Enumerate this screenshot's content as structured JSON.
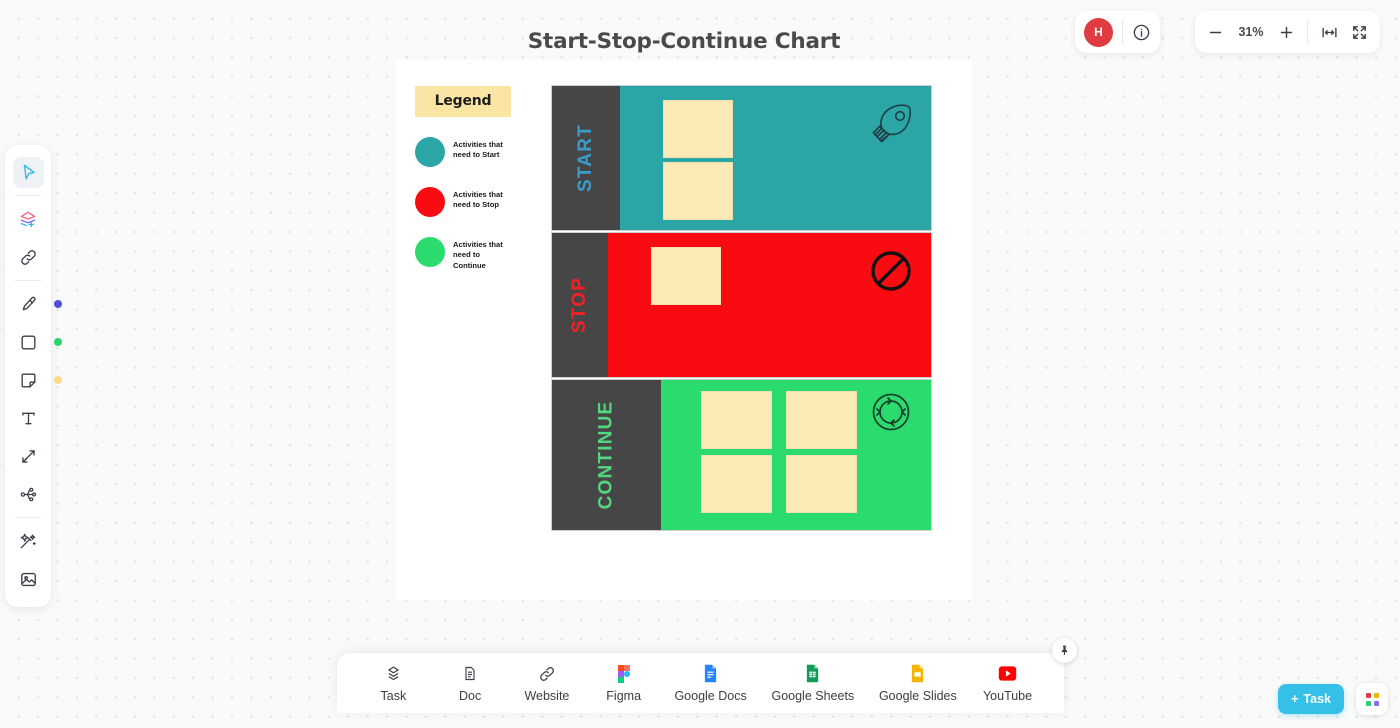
{
  "board": {
    "title": "Start-Stop-Continue Chart"
  },
  "legend": {
    "title": "Legend",
    "items": [
      {
        "color": "#2ba5a6",
        "label": "Activities that need to Start"
      },
      {
        "color": "#fa0b11",
        "label": "Activities that need to Stop"
      },
      {
        "color": "#2bdb6e",
        "label": "Activities that need to Continue"
      }
    ]
  },
  "matrix": {
    "rows": [
      {
        "key": "start",
        "label": "START",
        "body_color": "#2ba5a6",
        "label_strip_color": "#464646",
        "label_text_color": "#3b9cc9",
        "icon": "rocket-icon",
        "notes_count": 2
      },
      {
        "key": "stop",
        "label": "STOP",
        "body_color": "#fa0b11",
        "label_strip_color": "#464646",
        "label_text_color": "#f62024",
        "icon": "no-entry-icon",
        "notes_count": 1
      },
      {
        "key": "continue",
        "label": "CONTINUE",
        "body_color": "#2bdb6e",
        "label_strip_color": "#464646",
        "label_text_color": "#53d680",
        "icon": "cycle-icon",
        "notes_count": 4
      }
    ],
    "note_color": "#fbeab5"
  },
  "left_toolbar": {
    "tools": [
      {
        "name": "select-tool",
        "icon": "cursor-icon",
        "active": true,
        "dot": null
      },
      {
        "name": "add-layer-tool",
        "icon": "layers-plus-icon",
        "active": false,
        "dot": null
      },
      {
        "name": "link-tool",
        "icon": "link-icon",
        "active": false,
        "dot": null
      },
      {
        "name": "pen-tool",
        "icon": "highlighter-icon",
        "active": false,
        "dot": "#4b4ede"
      },
      {
        "name": "shape-tool",
        "icon": "square-icon",
        "active": false,
        "dot": "#2bd46e"
      },
      {
        "name": "sticky-note-tool",
        "icon": "sticky-note-icon",
        "active": false,
        "dot": "#f8d98a"
      },
      {
        "name": "text-tool",
        "icon": "text-icon",
        "active": false,
        "dot": null
      },
      {
        "name": "connector-tool",
        "icon": "double-arrow-icon",
        "active": false,
        "dot": null
      },
      {
        "name": "mindmap-tool",
        "icon": "mindmap-icon",
        "active": false,
        "dot": null
      },
      {
        "name": "ai-tool",
        "icon": "magic-wand-icon",
        "active": false,
        "dot": null
      },
      {
        "name": "image-tool",
        "icon": "image-icon",
        "active": false,
        "dot": null
      }
    ]
  },
  "header": {
    "avatar_initial": "H",
    "avatar_color": "#e03b41",
    "info_icon": "info-icon",
    "zoom": {
      "minus_label": "zoom-out",
      "level": "31%",
      "plus_label": "zoom-in",
      "fit_width_label": "fit-width",
      "fullscreen_label": "fullscreen"
    }
  },
  "bottom_bar": {
    "items": [
      {
        "label": "Task",
        "icon": "task-icon"
      },
      {
        "label": "Doc",
        "icon": "doc-icon"
      },
      {
        "label": "Website",
        "icon": "link-icon"
      },
      {
        "label": "Figma",
        "icon": "figma-icon"
      },
      {
        "label": "Google Docs",
        "icon": "google-docs-icon"
      },
      {
        "label": "Google Sheets",
        "icon": "google-sheets-icon"
      },
      {
        "label": "Google Slides",
        "icon": "google-slides-icon"
      },
      {
        "label": "YouTube",
        "icon": "youtube-icon"
      }
    ],
    "pin_icon": "pin-icon"
  },
  "footer_actions": {
    "task_button_label": "Task",
    "task_button_plus": "+",
    "task_button_color": "#35c0e8",
    "apps_icon": "apps-grid-icon"
  }
}
